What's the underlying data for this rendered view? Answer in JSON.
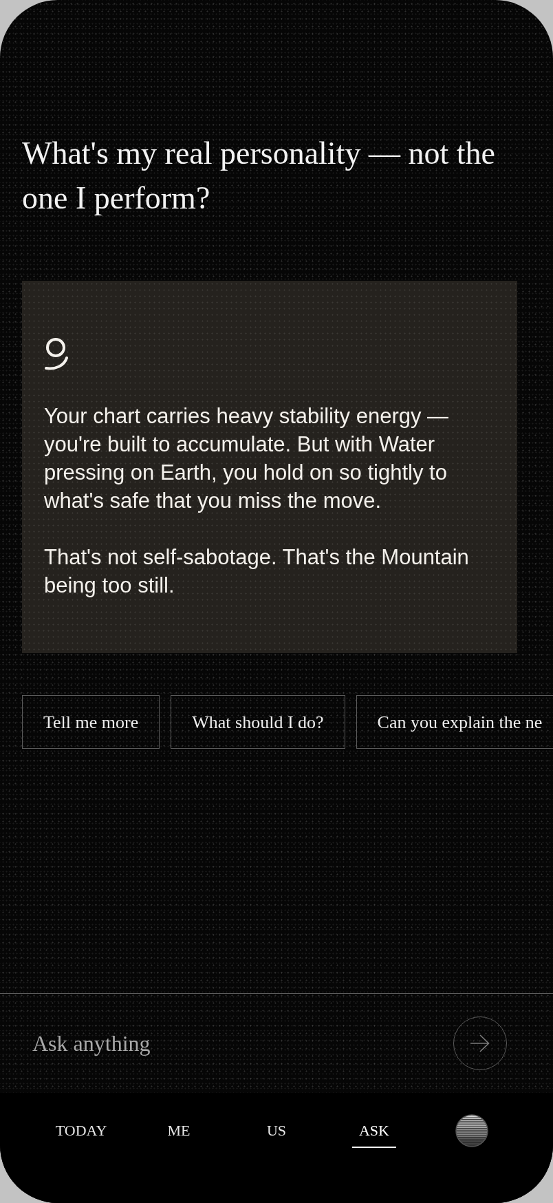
{
  "question": "What's my real personality — not the one I perform?",
  "answer": {
    "paragraphs": [
      "Your chart carries heavy stability energy — you're built to accumulate. But with Water pressing on Earth, you hold on so tightly to what's safe that you miss the move.",
      "That's not self-sabotage. That's the Mountain being too still."
    ]
  },
  "suggestions": [
    "Tell me more",
    "What should I do?",
    "Can you explain the ne"
  ],
  "input": {
    "placeholder": "Ask anything"
  },
  "tabs": [
    {
      "label": "TODAY",
      "selected": false
    },
    {
      "label": "ME",
      "selected": false
    },
    {
      "label": "US",
      "selected": false
    },
    {
      "label": "ASK",
      "selected": true
    }
  ]
}
